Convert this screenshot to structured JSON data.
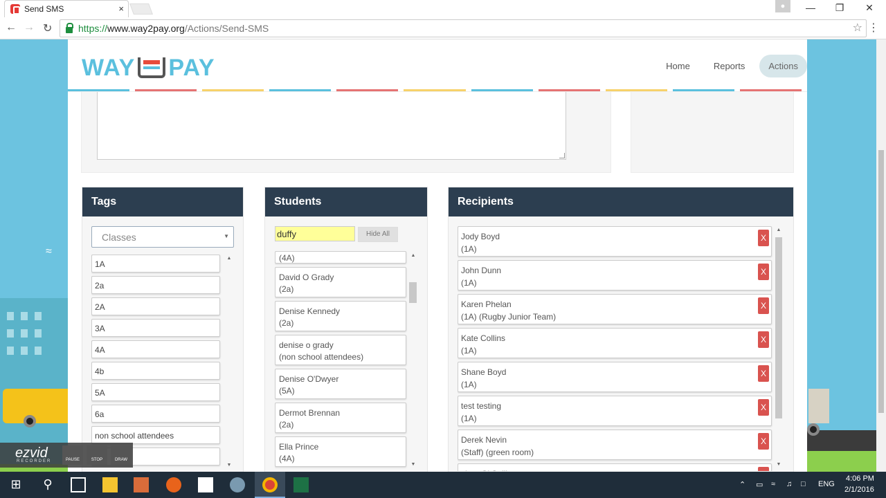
{
  "browser": {
    "tab_title": "Send SMS",
    "tab_close": "×",
    "url_https": "https://",
    "url_domain": "www.way2pay.org",
    "url_path": "/Actions/Send-SMS"
  },
  "header": {
    "logo_left": "WAY",
    "logo_right": "PAY",
    "nav": [
      "Home",
      "Reports",
      "Actions"
    ],
    "active_nav": "Actions",
    "stripe_colors": [
      "#5bc0de",
      "#e57373",
      "#f7d26b",
      "#5bc0de",
      "#e57373",
      "#f7d26b",
      "#5bc0de",
      "#e57373",
      "#f7d26b",
      "#5bc0de",
      "#e57373"
    ]
  },
  "tags": {
    "title": "Tags",
    "select_value": "Classes",
    "items": [
      "1A",
      "2a",
      "2A",
      "3A",
      "4A",
      "4b",
      "5A",
      "6a",
      "non school attendees",
      ""
    ]
  },
  "students": {
    "title": "Students",
    "search_value": "duffy",
    "hide_all_label": "Hide All",
    "partial_top": "(4A)",
    "items": [
      {
        "name": "David O Grady",
        "class": "(2a)"
      },
      {
        "name": "Denise Kennedy",
        "class": "(2a)"
      },
      {
        "name": "denise o grady",
        "class": "(non school attendees)"
      },
      {
        "name": "Denise O'Dwyer",
        "class": "(5A)"
      },
      {
        "name": "Dermot Brennan",
        "class": "(2a)"
      },
      {
        "name": "Ella Prince",
        "class": "(4A)"
      }
    ]
  },
  "recipients": {
    "title": "Recipients",
    "remove_label": "X",
    "items": [
      {
        "name": "Jody Boyd",
        "detail": "(1A)"
      },
      {
        "name": "John Dunn",
        "detail": "(1A)"
      },
      {
        "name": "Karen Phelan",
        "detail": "(1A) (Rugby Junior Team)"
      },
      {
        "name": "Kate Collins",
        "detail": "(1A)"
      },
      {
        "name": "Shane Boyd",
        "detail": "(1A)"
      },
      {
        "name": "test testing",
        "detail": "(1A)"
      },
      {
        "name": "Derek Nevin",
        "detail": "(Staff) (green room)"
      },
      {
        "name": "ciara O' Sullivan",
        "detail": ""
      }
    ]
  },
  "ezvid": {
    "brand": "ezvid",
    "sub": "RECORDER",
    "buttons": [
      "PAUSE",
      "STOP",
      "DRAW"
    ]
  },
  "taskbar": {
    "language": "ENG",
    "time": "4:06 PM",
    "date": "2/1/2016"
  }
}
